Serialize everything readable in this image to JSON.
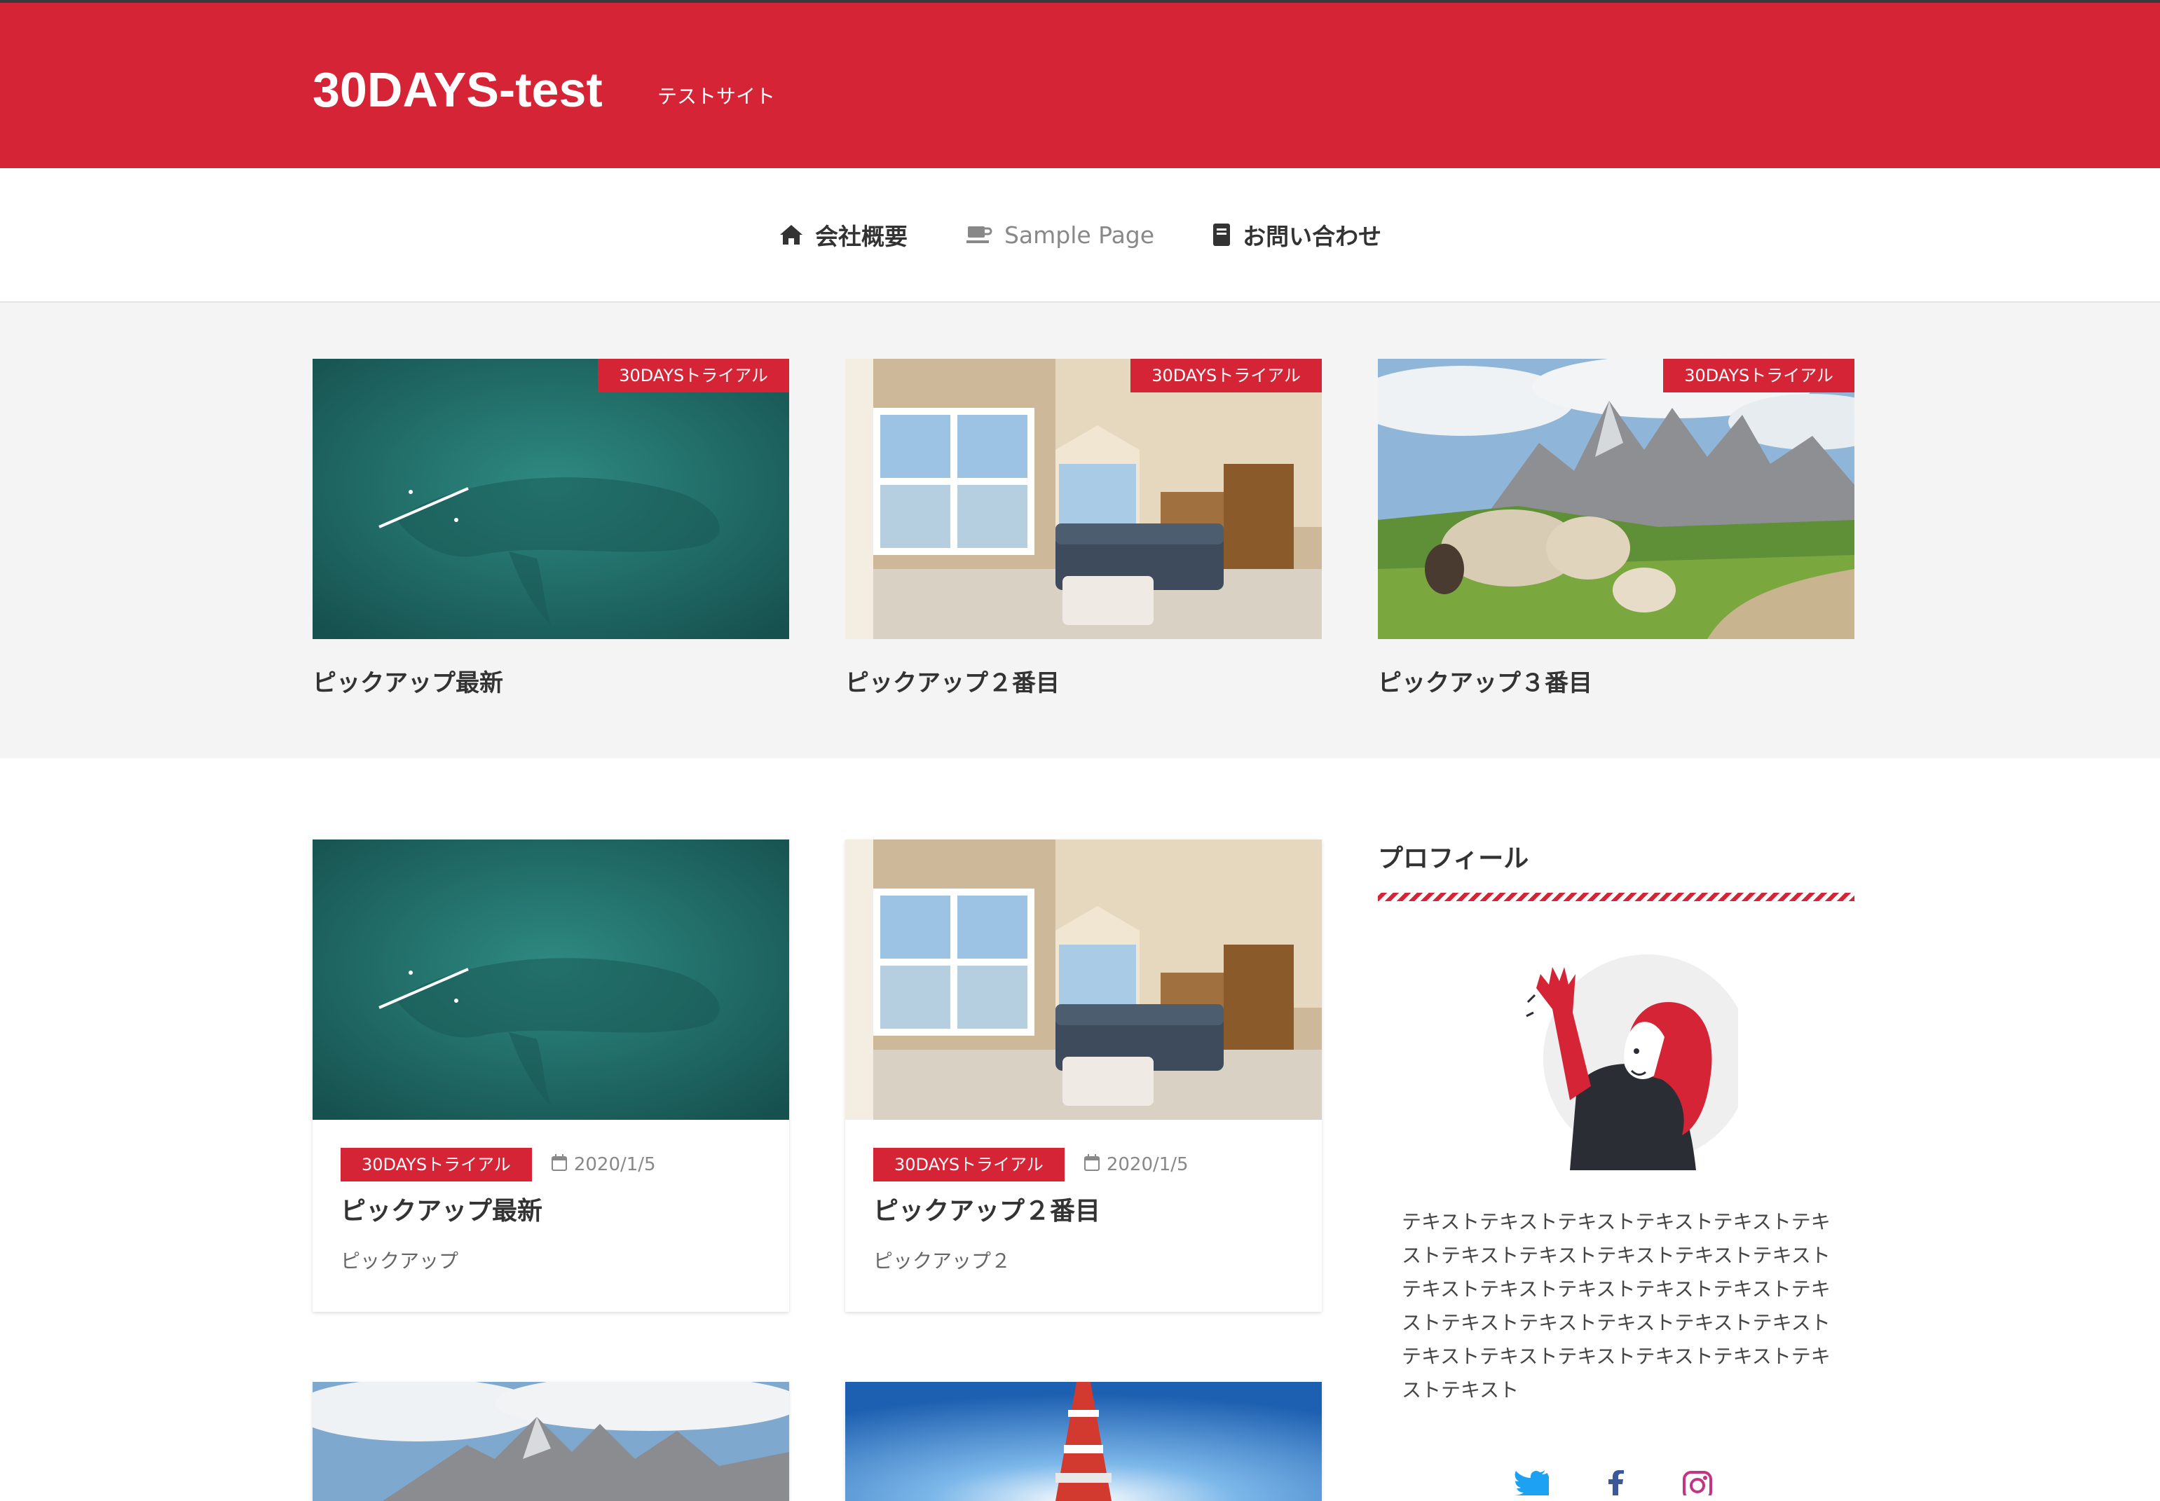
{
  "site": {
    "title": "30DAYS-test",
    "tagline": "テストサイト",
    "accent_color": "#d62437"
  },
  "nav": {
    "items": [
      {
        "icon": "home-icon",
        "label": "会社概要"
      },
      {
        "icon": "coffee-icon",
        "label": "Sample Page"
      },
      {
        "icon": "book-icon",
        "label": "お問い合わせ"
      }
    ]
  },
  "pickup": {
    "items": [
      {
        "category": "30DAYSトライアル",
        "title": "ピックアップ最新",
        "image": "aerial-whale-kayak"
      },
      {
        "category": "30DAYSトライアル",
        "title": "ピックアップ２番目",
        "image": "living-room"
      },
      {
        "category": "30DAYSトライアル",
        "title": "ピックアップ３番目",
        "image": "sheep-mountains"
      }
    ]
  },
  "articles": {
    "items": [
      {
        "category": "30DAYSトライアル",
        "date": "2020/1/5",
        "title": "ピックアップ最新",
        "excerpt": "ピックアップ",
        "image": "aerial-whale-kayak"
      },
      {
        "category": "30DAYSトライアル",
        "date": "2020/1/5",
        "title": "ピックアップ２番目",
        "excerpt": "ピックアップ２",
        "image": "living-room"
      },
      {
        "image": "mountains"
      },
      {
        "image": "tokyo-tower"
      }
    ]
  },
  "sidebar": {
    "profile": {
      "title": "プロフィール",
      "text": "テキストテキストテキストテキストテキストテキストテキストテキストテキストテキストテキストテキストテキストテキストテキストテキストテキストテキストテキストテキストテキストテキストテキストテキストテキストテキストテキストテキストテキスト",
      "social": [
        {
          "icon": "twitter-icon",
          "color": "#1da1f2"
        },
        {
          "icon": "facebook-icon",
          "color": "#3b5998"
        },
        {
          "icon": "instagram-icon",
          "color": "#c13584"
        }
      ]
    }
  }
}
